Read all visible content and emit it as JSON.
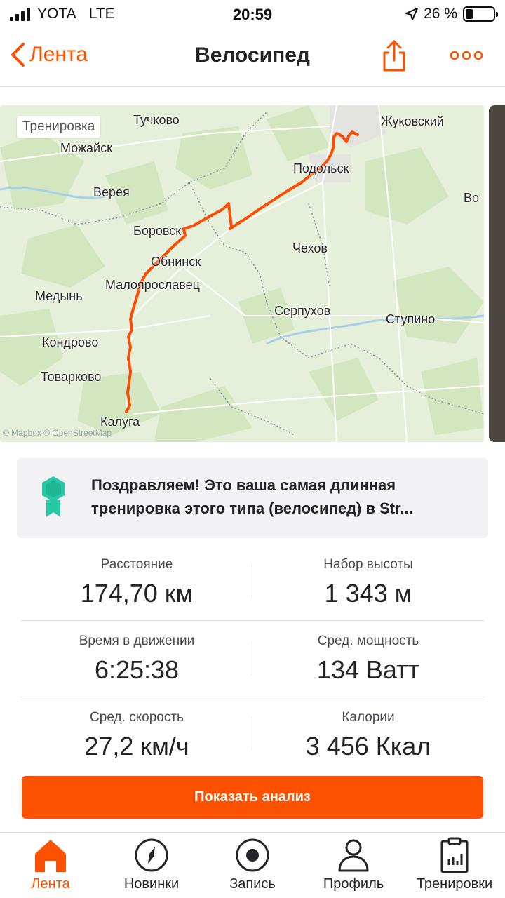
{
  "status_bar": {
    "carrier": "YOTA",
    "network": "LTE",
    "time": "20:59",
    "battery": "26 %"
  },
  "nav": {
    "back_label": "Лента",
    "title": "Велосипед"
  },
  "map": {
    "badge": "Тренировка",
    "credit": "© Mapbox © OpenStreetMap",
    "labels": {
      "tuchkovo": "Тучково",
      "mozhaysk": "Можайск",
      "zhukovsky": "Жуковский",
      "podolsk": "Подольск",
      "vereya": "Верея",
      "vo": "Во",
      "borovsk": "Боровск",
      "chekhov": "Чехов",
      "obninsk": "Обнинск",
      "maloyaroslavets": "Малоярославец",
      "medyn": "Медынь",
      "serpukhov": "Серпухов",
      "stupino": "Ступино",
      "kondrovo": "Кондрово",
      "tovarkovo": "Товарково",
      "kaluga": "Калуга"
    },
    "colors": {
      "route": "#fc4c02",
      "land": "#e6efd9",
      "forest": "#d3e6c0"
    }
  },
  "achievement": {
    "line1": "Поздравляем! Это ваша самая длинная",
    "line2": "тренировка этого типа (велосипед) в Str..."
  },
  "stats": {
    "distance": {
      "label": "Расстояние",
      "value": "174,70 км"
    },
    "elevation": {
      "label": "Набор высоты",
      "value": "1 343 м"
    },
    "moving_time": {
      "label": "Время в движении",
      "value": "6:25:38"
    },
    "avg_power": {
      "label": "Сред. мощность",
      "value": "134 Ватт"
    },
    "avg_speed": {
      "label": "Сред. скорость",
      "value": "27,2 км/ч"
    },
    "calories": {
      "label": "Калории",
      "value": "3 456 Ккал"
    }
  },
  "analysis_button": "Показать анализ",
  "tabs": [
    {
      "label": "Лента",
      "icon": "home-icon",
      "active": true
    },
    {
      "label": "Новинки",
      "icon": "compass-icon",
      "active": false
    },
    {
      "label": "Запись",
      "icon": "record-icon",
      "active": false
    },
    {
      "label": "Профиль",
      "icon": "profile-icon",
      "active": false
    },
    {
      "label": "Тренировки",
      "icon": "clipboard-chart-icon",
      "active": false
    }
  ],
  "colors": {
    "accent": "#fc5200"
  }
}
